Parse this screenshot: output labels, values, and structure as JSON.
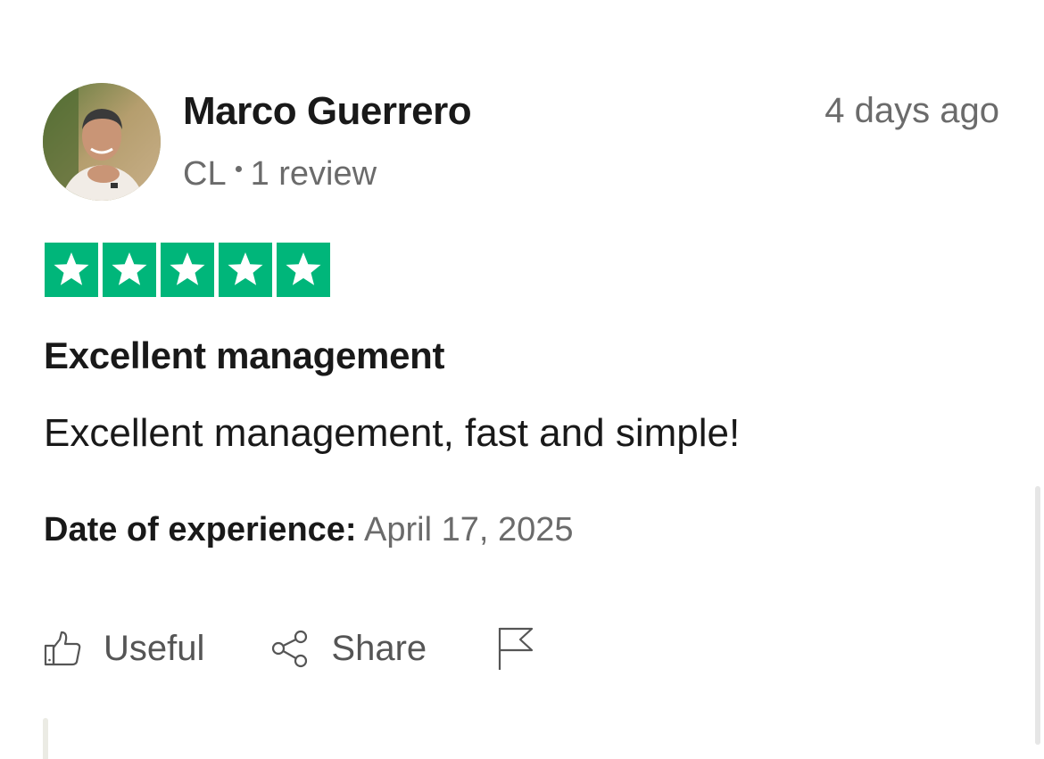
{
  "review": {
    "reviewer": {
      "name": "Marco Guerrero",
      "country": "CL",
      "review_count": "1 review",
      "avatar_icon": "user-photo-avatar"
    },
    "posted": "4 days ago",
    "rating": {
      "stars": 5,
      "max": 5,
      "color": "#00b67a"
    },
    "title": "Excellent management",
    "body": "Excellent management, fast and simple!",
    "experience": {
      "label": "Date of experience:",
      "date": "April 17, 2025"
    },
    "actions": {
      "useful_label": "Useful",
      "useful_icon": "thumbs-up-icon",
      "share_label": "Share",
      "share_icon": "share-icon",
      "report_icon": "flag-icon"
    }
  }
}
